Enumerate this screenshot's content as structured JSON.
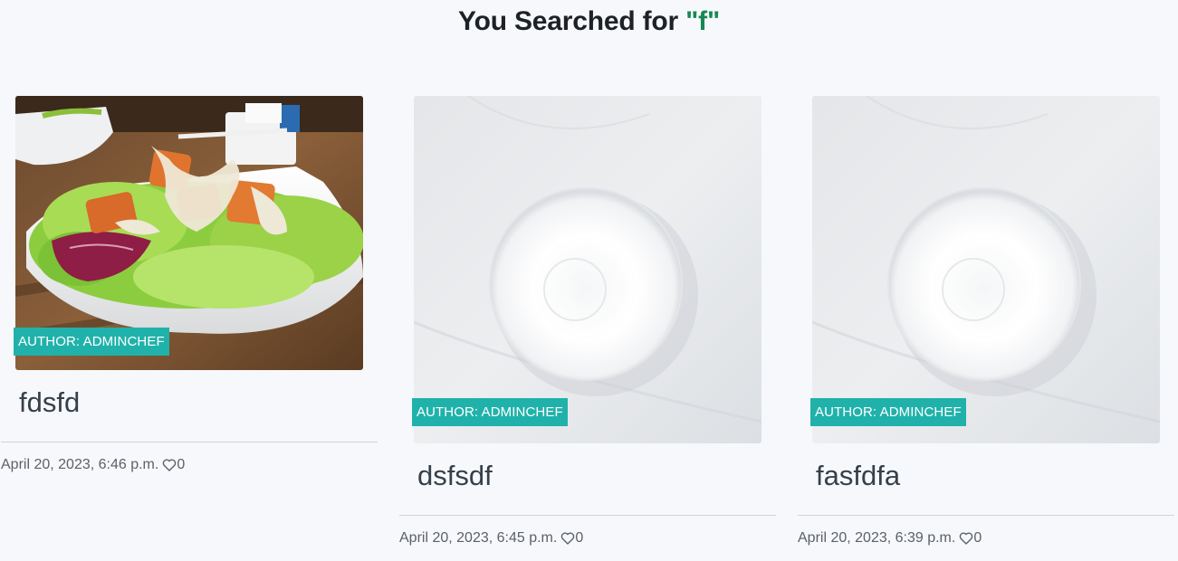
{
  "header": {
    "prefix": "You Searched for ",
    "query": "\"f\""
  },
  "colors": {
    "badge": "#20b2aa",
    "query": "#198754",
    "title": "#36404a"
  },
  "results": [
    {
      "title": "fdsfd",
      "author_badge": "AUTHOR: ADMINCHEF",
      "date": "April 20, 2023, 6:46 p.m.",
      "likes": "0",
      "image_icon": "salad-photo"
    },
    {
      "title": "dsfsdf",
      "author_badge": "AUTHOR: ADMINCHEF",
      "date": "April 20, 2023, 6:45 p.m.",
      "likes": "0",
      "image_icon": "empty-bowl-photo"
    },
    {
      "title": "fasfdfa",
      "author_badge": "AUTHOR: ADMINCHEF",
      "date": "April 20, 2023, 6:39 p.m.",
      "likes": "0",
      "image_icon": "empty-bowl-photo"
    }
  ]
}
